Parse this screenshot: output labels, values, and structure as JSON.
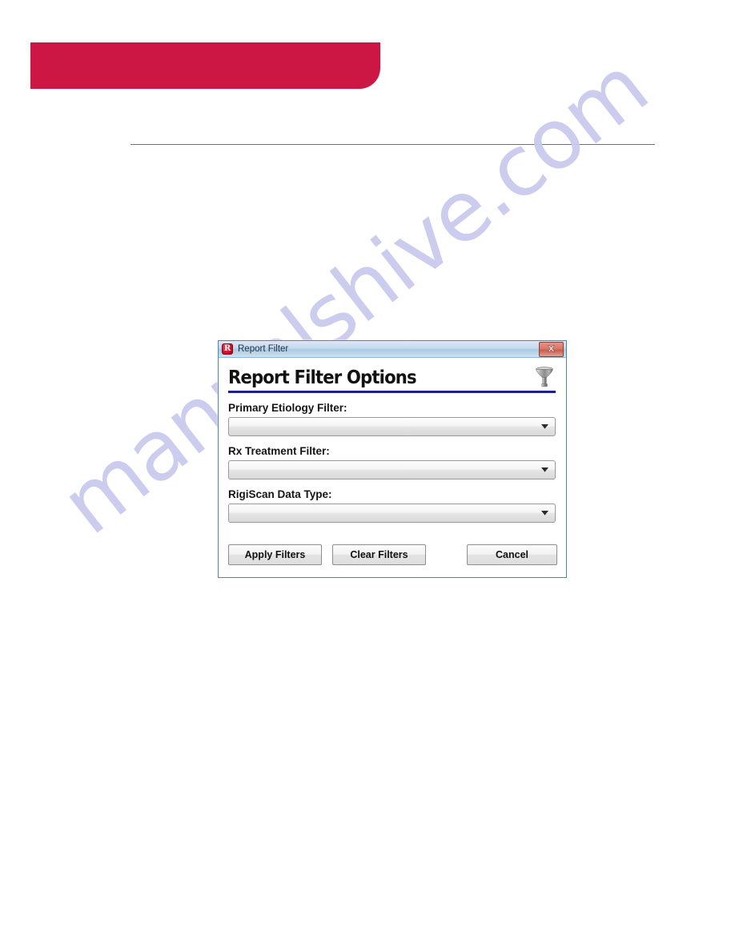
{
  "page": {
    "background_color": "#ffffff",
    "header_band_color": "#cc1744",
    "rule_color": "#6e6e73",
    "watermark_text": "manualshive.com",
    "watermark_color": "#c9caee"
  },
  "dialog": {
    "titlebar": {
      "app_icon": "report-filter-app-icon",
      "icon_letter": "R",
      "title": "Report Filter",
      "close_icon": "close-icon",
      "close_color": "#c85c4d"
    },
    "heading": {
      "text": "Report Filter Options",
      "icon": "funnel-icon",
      "rule_color": "#1d1d9c"
    },
    "fields": [
      {
        "label": "Primary Etiology Filter:",
        "name": "primary-etiology-filter",
        "value": "",
        "caret_icon": "chevron-down-icon"
      },
      {
        "label": "Rx Treatment Filter:",
        "name": "rx-treatment-filter",
        "value": "",
        "caret_icon": "chevron-down-icon"
      },
      {
        "label": "RigiScan Data Type:",
        "name": "rigiscan-data-type",
        "value": "",
        "caret_icon": "chevron-down-icon"
      }
    ],
    "buttons": {
      "apply": "Apply Filters",
      "clear": "Clear Filters",
      "cancel": "Cancel"
    }
  }
}
